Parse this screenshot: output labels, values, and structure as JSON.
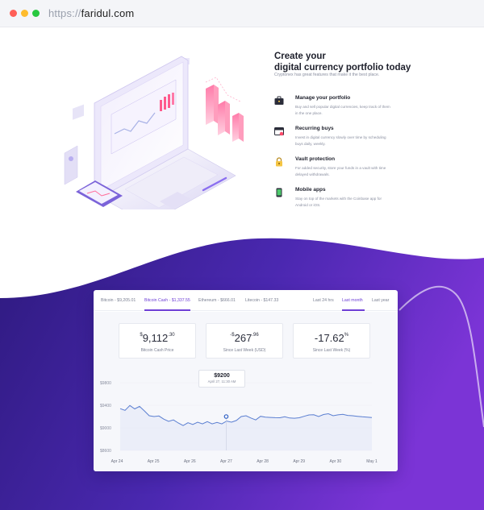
{
  "browser": {
    "url_protocol": "https://",
    "url_host": "faridul.com"
  },
  "hero": {
    "title_line1": "Create your",
    "title_line2": "digital currency portfolio today",
    "subtitle": "Cryptonex has great features that make it the best place.",
    "features": [
      {
        "icon": "briefcase-icon",
        "title": "Manage your portfolio",
        "desc": "Buy and sell popular digital currencies, keep track of them in the one place."
      },
      {
        "icon": "calendar-icon",
        "title": "Recurring buys",
        "desc": "Invest in digital currency slowly over time by scheduling buys daily, weekly."
      },
      {
        "icon": "lock-icon",
        "title": "Vault protection",
        "desc": "For added security, store your funds in a vault with time delayed withdrawals."
      },
      {
        "icon": "phone-icon",
        "title": "Mobile apps",
        "desc": "Stay on top of the markets with the Coinbase app for Android or iOS."
      }
    ]
  },
  "card": {
    "coin_tabs": [
      "Bitcoin - $9,205.01",
      "Bitcoin Cash - $1,337.55",
      "Ethereum - $666.01",
      "Litecoin - $147.33"
    ],
    "active_coin_tab": 1,
    "period_tabs": [
      "Last 24 hrs",
      "Last month",
      "Last year"
    ],
    "active_period_tab": 1,
    "stats": [
      {
        "prefix": "$",
        "main": "9,112",
        "sup": ".30",
        "label": "Bitcoin Cash Price"
      },
      {
        "prefix": "-$",
        "main": "267",
        "sup": ".96",
        "label": "Since Last Week (USD)"
      },
      {
        "prefix": "",
        "main": "-17.62",
        "sup": "%",
        "label": "Since Last Week (%)"
      }
    ],
    "tooltip": {
      "value": "$9200",
      "date": "April 27, 11:30 AM"
    }
  },
  "chart_data": {
    "type": "line",
    "x_labels": [
      "Apr 24",
      "Apr 25",
      "Apr 26",
      "Apr 27",
      "Apr 28",
      "Apr 29",
      "Apr 30",
      "May 1"
    ],
    "y_ticks": [
      "$9800",
      "$9400",
      "$9000",
      "$8600"
    ],
    "ylim": [
      8600,
      9800
    ],
    "series": [
      {
        "values": [
          9340,
          9310,
          9395,
          9335,
          9380,
          9300,
          9215,
          9200,
          9210,
          9155,
          9115,
          9140,
          9085,
          9040,
          9090,
          9060,
          9100,
          9070,
          9110,
          9070,
          9095,
          9070,
          9120,
          9100,
          9130,
          9200,
          9215,
          9175,
          9140,
          9205,
          9190,
          9185,
          9180,
          9178,
          9195,
          9175,
          9170,
          9178,
          9205,
          9228,
          9232,
          9200,
          9235,
          9250,
          9215,
          9230,
          9238,
          9220,
          9215,
          9205,
          9195,
          9190,
          9182
        ]
      }
    ],
    "highlight": {
      "x": "Apr 27",
      "value": 9200
    },
    "colors": {
      "line": "#5b7fd1",
      "fill": "#dfe5f8"
    }
  }
}
